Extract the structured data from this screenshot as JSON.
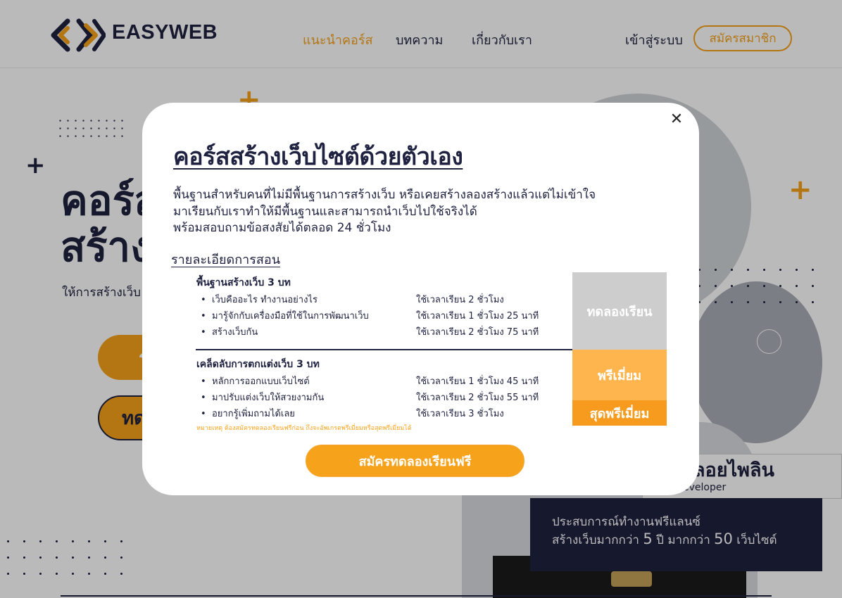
{
  "header": {
    "logo_text": "EASYWEB",
    "nav": [
      "แนะนำคอร์ส",
      "บทความ",
      "เกี่ยวกับเรา"
    ],
    "login": "เข้าสู่ระบบ",
    "signup": "สมัครสมาชิก",
    "accent_color": "#f7a21b",
    "brand_color": "#1f2240"
  },
  "hero": {
    "title_line1": "คอร์ส",
    "title_line2": "สร้าง",
    "subtitle": "ให้การสร้างเว็บ",
    "btn_primary_visible": "ร",
    "btn_secondary_visible": "ทด"
  },
  "profile": {
    "name": "ลอยไพลิน",
    "role": "eveloper",
    "experience_line1": "ประสบการณ์ทำงานฟรีแลนซ์",
    "experience_prefix": "สร้างเว็บมากกว่า",
    "years": "5",
    "years_unit": "ปี มากกว่า",
    "sites": "50",
    "sites_unit": "เว็บไซต์"
  },
  "modal": {
    "title": "คอร์สสร้างเว็บไซต์ด้วยตัวเอง",
    "desc_line1": "พื้นฐานสำหรับคนที่ไม่มีพื้นฐานการสร้างเว็บ หรือเคยสร้างลองสร้างแล้วแต่ไม่เข้าใจ",
    "desc_line2": "มาเรียนกับเราทำให้มีพื้นฐานและสามารถนำเว็บไปใช้จริงได้",
    "desc_line3": "พร้อมสอบถามข้อสงสัยได้ตลอด 24 ชั่วโมง",
    "section_title": "รายละเอียดการสอน",
    "groups": [
      {
        "title": "พื้นฐานสร้างเว็บ 3 บท",
        "lessons": [
          {
            "name": "เว็บคืออะไร ทำงานอย่างไร",
            "duration": "ใช้เวลาเรียน 2 ชั่วโมง"
          },
          {
            "name": "มารู้จักกับเครื่องมือที่ใช้ในการพัฒนาเว็บ",
            "duration": "ใช้เวลาเรียน 1 ชั่วโมง 25 นาที"
          },
          {
            "name": "สร้างเว็บกัน",
            "duration": "ใช้เวลาเรียน 2 ชั่วโมง 75 นาที"
          }
        ]
      },
      {
        "title": "เคล็ดลับการตกแต่งเว็บ 3 บท",
        "lessons": [
          {
            "name": "หลักการออกแบบเว็บไซต์",
            "duration": "ใช้เวลาเรียน 1 ชั่วโมง 45 นาที"
          },
          {
            "name": "มาปรับแต่งเว็บให้สวยงามกัน",
            "duration": "ใช้เวลาเรียน 2 ชั่วโมง 55 นาที"
          },
          {
            "name": "อยากรู้เพิ่มถามได้เลย",
            "duration": "ใช้เวลาเรียน 3 ชั่วโมง"
          }
        ]
      }
    ],
    "tiers": [
      "ทดลองเรียน",
      "พรีเมี่ยม",
      "สุดพรีเมี่ยม"
    ],
    "note": "หมายเหตุ ต้องสมัครทดลองเรียนฟรีก่อน ถึงจะอัพเกรดพรีเมี่ยมหรือสุดพรีเมี่ยมได้",
    "cta": "สมัครทดลองเรียนฟรี",
    "close_icon": "close-icon"
  }
}
